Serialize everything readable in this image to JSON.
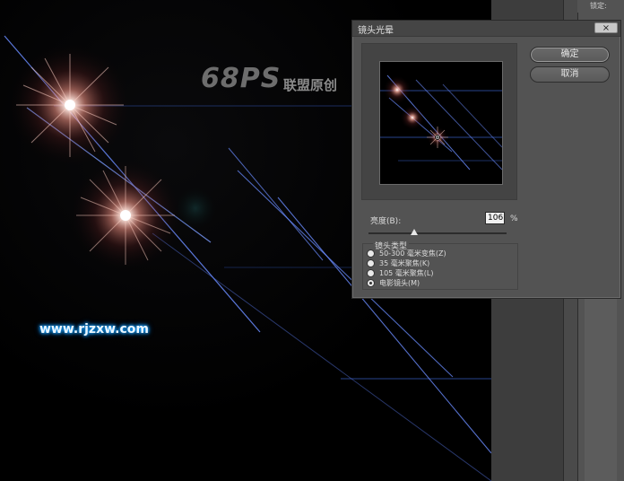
{
  "canvas": {
    "watermark_text": "68PS",
    "watermark_cn": "联盟原创",
    "site_url": "www.rjzxw.com"
  },
  "dock": {
    "tab_label": "锁定:"
  },
  "dialog": {
    "title": "镜头光晕",
    "close_glyph": "×",
    "ok_label": "确定",
    "cancel_label": "取消",
    "brightness_label": "亮度(B):",
    "brightness_value": "106",
    "brightness_unit": "%",
    "brightness_percent": 106,
    "brightness_min": 10,
    "brightness_max": 300,
    "lens_type_title": "镜头类型",
    "lens_options": [
      {
        "label": "50-300 毫米变焦(Z)",
        "checked": false
      },
      {
        "label": "35 毫米聚焦(K)",
        "checked": false
      },
      {
        "label": "105 毫米聚焦(L)",
        "checked": false
      },
      {
        "label": "电影镜头(M)",
        "checked": true
      }
    ]
  },
  "colors": {
    "flare_core": "#ffffff",
    "flare_glow": "#ff8a7a",
    "streak_blue": "#5c8cff",
    "url_glow": "#1aa3ff"
  }
}
